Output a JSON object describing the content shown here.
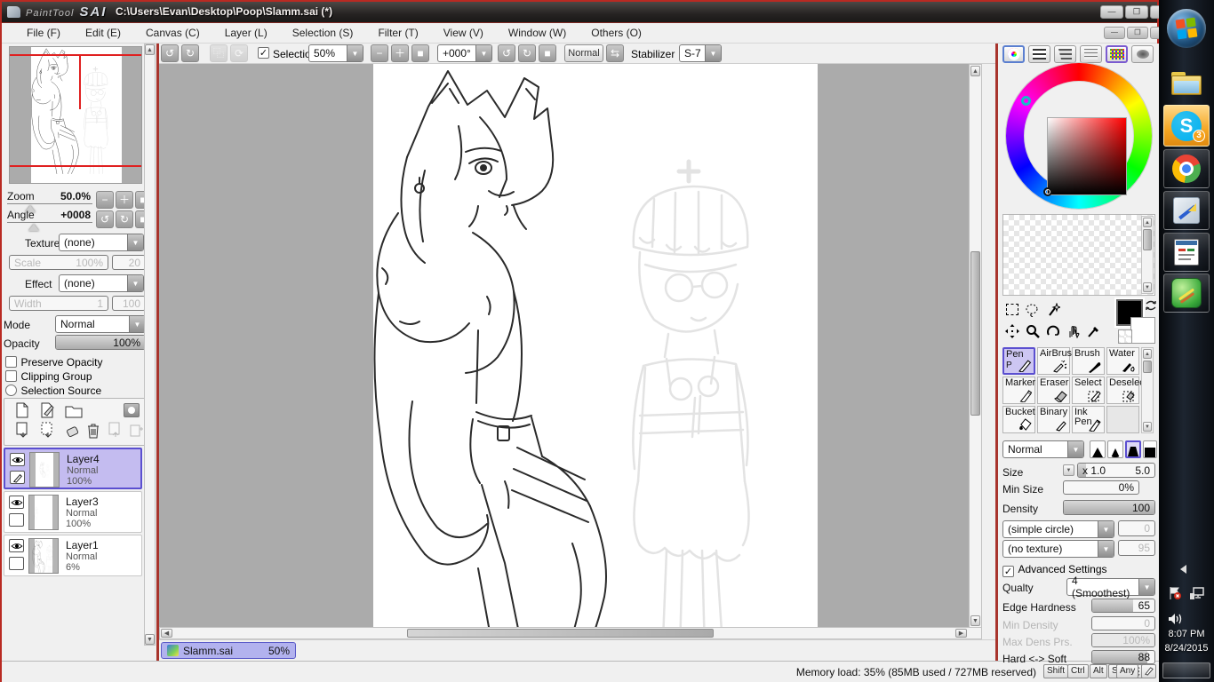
{
  "window": {
    "app_brand": "PaintTool",
    "app_brand2": "SAI",
    "document_title": "C:\\Users\\Evan\\Desktop\\Poop\\Slamm.sai (*)"
  },
  "menu": {
    "items": [
      "File (F)",
      "Edit (E)",
      "Canvas (C)",
      "Layer (L)",
      "Selection (S)",
      "Filter (T)",
      "View (V)",
      "Window (W)",
      "Others (O)"
    ]
  },
  "toolbar": {
    "selection_label": "Selection",
    "zoom_value": "50%",
    "angle_value": "+000°",
    "blend_button": "Normal",
    "stabilizer_label": "Stabilizer",
    "stabilizer_value": "S-7"
  },
  "navigator": {
    "zoom_label": "Zoom",
    "zoom_value": "50.0%",
    "angle_label": "Angle",
    "angle_value": "+0008"
  },
  "paint": {
    "texture_label": "Texture",
    "texture_value": "(none)",
    "scale_label": "Scale",
    "scale_value": "100%",
    "scale_strength": "20",
    "effect_label": "Effect",
    "effect_value": "(none)",
    "width_label": "Width",
    "width_value": "1",
    "width_strength": "100",
    "mode_label": "Mode",
    "mode_value": "Normal",
    "opacity_label": "Opacity",
    "opacity_value": "100%"
  },
  "layer_options": {
    "preserve_opacity": "Preserve Opacity",
    "clipping_group": "Clipping Group",
    "selection_source": "Selection Source"
  },
  "layers": [
    {
      "name": "Layer4",
      "mode": "Normal",
      "opacity": "100%"
    },
    {
      "name": "Layer3",
      "mode": "Normal",
      "opacity": "100%"
    },
    {
      "name": "Layer1",
      "mode": "Normal",
      "opacity": "6%"
    }
  ],
  "tools": {
    "items": [
      "Pen",
      "AirBrush",
      "Brush",
      "Water",
      "Marker",
      "Eraser",
      "Select",
      "Deselect",
      "Bucket",
      "Binary",
      "Ink Pen"
    ],
    "pen_shortcut": "P"
  },
  "brush": {
    "blend_value": "Normal",
    "size_label": "Size",
    "size_mult": "x 1.0",
    "size_value": "5.0",
    "min_size_label": "Min Size",
    "min_size_value": "0%",
    "density_label": "Density",
    "density_value": "100",
    "shape_value": "(simple circle)",
    "shape_strength": "0",
    "texture_value": "(no texture)",
    "texture_strength": "95"
  },
  "advanced": {
    "label": "Advanced Settings",
    "quality_label": "Qualty",
    "quality_value": "4 (Smoothest)",
    "edge_label": "Edge Hardness",
    "edge_value": "65",
    "min_density_label": "Min Density",
    "min_density_value": "0",
    "max_dens_label": "Max Dens Prs.",
    "max_dens_value": "100%",
    "hard_soft_label": "Hard <-> Soft",
    "hard_soft_value": "88"
  },
  "canvas_tab": {
    "name": "Slamm.sai",
    "zoom": "50%"
  },
  "statusbar": {
    "memory": "Memory load: 35% (85MB used / 727MB reserved)",
    "keys": [
      "Shift",
      "Ctrl",
      "Alt",
      "SPC"
    ],
    "any_label": "Any"
  },
  "taskbar": {
    "time": "8:07 PM",
    "date": "8/24/2015",
    "skype_badge": "3"
  },
  "colors": {
    "red_border": "#b92a22",
    "selection_highlight": "#c4bcf0",
    "tab_highlight": "#b2b2ee",
    "canvas_surround": "#ababab"
  }
}
